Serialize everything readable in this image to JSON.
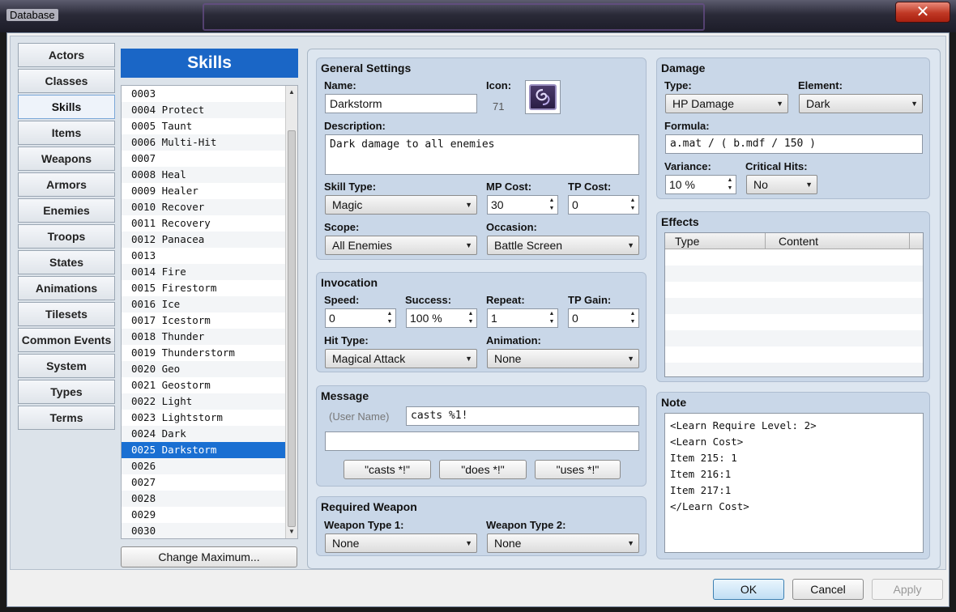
{
  "window": {
    "title": "Database",
    "close": "✕"
  },
  "tabs": [
    "Actors",
    "Classes",
    "Skills",
    "Items",
    "Weapons",
    "Armors",
    "Enemies",
    "Troops",
    "States",
    "Animations",
    "Tilesets",
    "Common Events",
    "System",
    "Types",
    "Terms"
  ],
  "active_tab": "Skills",
  "list": {
    "header": "Skills",
    "rows": [
      "0003",
      "0004 Protect",
      "0005 Taunt",
      "0006 Multi-Hit",
      "0007",
      "0008 Heal",
      "0009 Healer",
      "0010 Recover",
      "0011 Recovery",
      "0012 Panacea",
      "0013",
      "0014 Fire",
      "0015 Firestorm",
      "0016 Ice",
      "0017 Icestorm",
      "0018 Thunder",
      "0019 Thunderstorm",
      "0020 Geo",
      "0021 Geostorm",
      "0022 Light",
      "0023 Lightstorm",
      "0024 Dark",
      "0025 Darkstorm",
      "0026",
      "0027",
      "0028",
      "0029",
      "0030"
    ],
    "selected": "0025 Darkstorm",
    "change_max": "Change Maximum..."
  },
  "general": {
    "title": "General Settings",
    "name_label": "Name:",
    "name": "Darkstorm",
    "icon_label": "Icon:",
    "icon_index": "71",
    "desc_label": "Description:",
    "desc": "Dark damage to all enemies",
    "skill_type_label": "Skill Type:",
    "skill_type": "Magic",
    "mp_label": "MP Cost:",
    "mp": "30",
    "tp_label": "TP Cost:",
    "tp": "0",
    "scope_label": "Scope:",
    "scope": "All Enemies",
    "occasion_label": "Occasion:",
    "occasion": "Battle Screen"
  },
  "invocation": {
    "title": "Invocation",
    "speed_label": "Speed:",
    "speed": "0",
    "success_label": "Success:",
    "success": "100 %",
    "repeat_label": "Repeat:",
    "repeat": "1",
    "tpgain_label": "TP Gain:",
    "tpgain": "0",
    "hit_label": "Hit Type:",
    "hit": "Magical Attack",
    "anim_label": "Animation:",
    "anim": "None"
  },
  "message": {
    "title": "Message",
    "user_name": "(User Name)",
    "line1": "casts %1!",
    "line2": "",
    "btn_casts": "\"casts *!\"",
    "btn_does": "\"does *!\"",
    "btn_uses": "\"uses *!\""
  },
  "weapon": {
    "title": "Required Weapon",
    "wt1_label": "Weapon Type 1:",
    "wt1": "None",
    "wt2_label": "Weapon Type 2:",
    "wt2": "None"
  },
  "damage": {
    "title": "Damage",
    "type_label": "Type:",
    "type": "HP Damage",
    "element_label": "Element:",
    "element": "Dark",
    "formula_label": "Formula:",
    "formula": "a.mat / ( b.mdf / 150 )",
    "variance_label": "Variance:",
    "variance": "10 %",
    "crit_label": "Critical Hits:",
    "crit": "No"
  },
  "effects": {
    "title": "Effects",
    "col_type": "Type",
    "col_content": "Content"
  },
  "note": {
    "title": "Note",
    "lines": [
      "<Learn Require Level: 2>",
      "<Learn Cost>",
      "Item 215: 1",
      "Item 216:1",
      "Item 217:1",
      "</Learn Cost>"
    ]
  },
  "footer": {
    "ok": "OK",
    "cancel": "Cancel",
    "apply": "Apply"
  },
  "colors": {
    "accent": "#1a66c6",
    "selection": "#1a6fd2",
    "panel": "#c9d7e8"
  }
}
